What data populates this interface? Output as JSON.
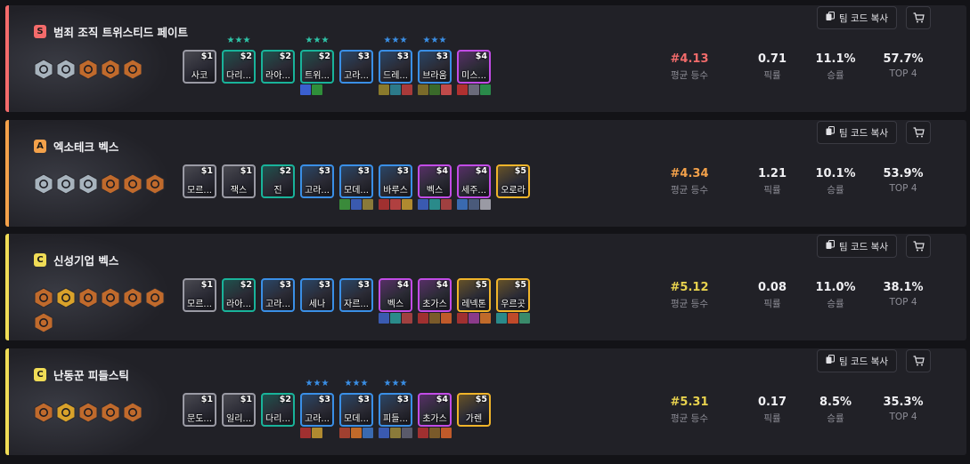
{
  "labels": {
    "copy_code": "팀 코드 복사",
    "avg_rank_label": "평균 등수",
    "pick_label": "픽률",
    "win_label": "승률",
    "top4_label": "TOP 4"
  },
  "colors": {
    "tier_S": "#f46b6b",
    "tier_A": "#f3a14a",
    "tier_C": "#f0dc56",
    "cost_1": "#9a9aa4",
    "cost_2": "#19b39a",
    "cost_3": "#3a8fe6",
    "cost_4": "#c24ce6",
    "cost_5": "#f0b42a",
    "star_2": "#2fc4a8",
    "star_3": "#3a8fe6",
    "trait_silver": "#a7b3bd",
    "trait_bronze": "#c06a2c",
    "trait_gold": "#d9a22a"
  },
  "comps": [
    {
      "tier": "S",
      "name": "범죄 조직 트위스티드 페이트",
      "traits": [
        "silver",
        "silver",
        "bronze",
        "bronze",
        "bronze"
      ],
      "units": [
        {
          "cost": "$1",
          "name": "사코",
          "tier": 1,
          "stars": "",
          "star_tier": 0,
          "items": []
        },
        {
          "cost": "$2",
          "name": "다리...",
          "tier": 2,
          "stars": "★★★",
          "star_tier": 2,
          "items": []
        },
        {
          "cost": "$2",
          "name": "라아...",
          "tier": 2,
          "stars": "",
          "star_tier": 0,
          "items": []
        },
        {
          "cost": "$2",
          "name": "트위...",
          "tier": 2,
          "stars": "★★★",
          "star_tier": 2,
          "items": [
            "#3a5fd0",
            "#2f8f3a"
          ]
        },
        {
          "cost": "$3",
          "name": "고라...",
          "tier": 3,
          "stars": "",
          "star_tier": 0,
          "items": []
        },
        {
          "cost": "$3",
          "name": "드레...",
          "tier": 3,
          "stars": "★★★",
          "star_tier": 3,
          "items": [
            "#8a7a2c",
            "#2c7a8a",
            "#a83a3a"
          ]
        },
        {
          "cost": "$3",
          "name": "브라움",
          "tier": 3,
          "stars": "★★★",
          "star_tier": 3,
          "items": [
            "#7a6a2a",
            "#3a6a2a",
            "#c04a4a"
          ]
        },
        {
          "cost": "$4",
          "name": "미스...",
          "tier": 4,
          "stars": "",
          "star_tier": 0,
          "items": [
            "#b03030",
            "#6a6a7a",
            "#2a8a4a"
          ]
        }
      ],
      "avg_rank": "#4.13",
      "pick": "0.71",
      "win": "11.1%",
      "top4": "57.7%"
    },
    {
      "tier": "A",
      "name": "엑소테크 벡스",
      "traits": [
        "silver",
        "silver",
        "silver",
        "bronze",
        "bronze",
        "bronze"
      ],
      "units": [
        {
          "cost": "$1",
          "name": "모르...",
          "tier": 1,
          "stars": "",
          "star_tier": 0,
          "items": []
        },
        {
          "cost": "$1",
          "name": "잭스",
          "tier": 1,
          "stars": "",
          "star_tier": 0,
          "items": []
        },
        {
          "cost": "$2",
          "name": "진",
          "tier": 2,
          "stars": "",
          "star_tier": 0,
          "items": []
        },
        {
          "cost": "$3",
          "name": "고라...",
          "tier": 3,
          "stars": "",
          "star_tier": 0,
          "items": []
        },
        {
          "cost": "$3",
          "name": "모데...",
          "tier": 3,
          "stars": "",
          "star_tier": 0,
          "items": [
            "#3a8a3a",
            "#3a5ab0",
            "#8a7a3a"
          ]
        },
        {
          "cost": "$3",
          "name": "바루스",
          "tier": 3,
          "stars": "",
          "star_tier": 0,
          "items": [
            "#a03030",
            "#b04040",
            "#b08a30"
          ]
        },
        {
          "cost": "$4",
          "name": "벡스",
          "tier": 4,
          "stars": "",
          "star_tier": 0,
          "items": [
            "#3a5ab0",
            "#2a8a8a",
            "#a04040"
          ]
        },
        {
          "cost": "$4",
          "name": "세주...",
          "tier": 4,
          "stars": "",
          "star_tier": 0,
          "items": [
            "#3a6ab0",
            "#4a5a7a",
            "#9a9aa4"
          ]
        },
        {
          "cost": "$5",
          "name": "오로라",
          "tier": 5,
          "stars": "",
          "star_tier": 0,
          "items": []
        }
      ],
      "avg_rank": "#4.34",
      "pick": "1.21",
      "win": "10.1%",
      "top4": "53.9%"
    },
    {
      "tier": "C",
      "name": "신성기업 벡스",
      "traits": [
        "bronze",
        "gold",
        "bronze",
        "bronze",
        "bronze",
        "bronze",
        "bronze"
      ],
      "units": [
        {
          "cost": "$1",
          "name": "모르...",
          "tier": 1,
          "stars": "",
          "star_tier": 0,
          "items": []
        },
        {
          "cost": "$2",
          "name": "라아...",
          "tier": 2,
          "stars": "",
          "star_tier": 0,
          "items": []
        },
        {
          "cost": "$3",
          "name": "고라...",
          "tier": 3,
          "stars": "",
          "star_tier": 0,
          "items": []
        },
        {
          "cost": "$3",
          "name": "세나",
          "tier": 3,
          "stars": "",
          "star_tier": 0,
          "items": []
        },
        {
          "cost": "$3",
          "name": "자르...",
          "tier": 3,
          "stars": "",
          "star_tier": 0,
          "items": []
        },
        {
          "cost": "$4",
          "name": "벡스",
          "tier": 4,
          "stars": "",
          "star_tier": 0,
          "items": [
            "#3a5ab0",
            "#2a8a8a",
            "#a04040"
          ]
        },
        {
          "cost": "$4",
          "name": "초가스",
          "tier": 4,
          "stars": "",
          "star_tier": 0,
          "items": [
            "#a03030",
            "#7a5a2a",
            "#c05a2a"
          ]
        },
        {
          "cost": "$5",
          "name": "레넥톤",
          "tier": 5,
          "stars": "",
          "star_tier": 0,
          "items": [
            "#a03030",
            "#8a3a8a",
            "#c06a2a"
          ]
        },
        {
          "cost": "$5",
          "name": "우르곳",
          "tier": 5,
          "stars": "",
          "star_tier": 0,
          "items": [
            "#2a8a8a",
            "#c04a2a",
            "#3a8a6a"
          ]
        }
      ],
      "avg_rank": "#5.12",
      "pick": "0.08",
      "win": "11.0%",
      "top4": "38.1%"
    },
    {
      "tier": "C",
      "name": "난동꾼 피들스틱",
      "traits": [
        "bronze",
        "gold",
        "bronze",
        "bronze",
        "bronze"
      ],
      "units": [
        {
          "cost": "$1",
          "name": "문도...",
          "tier": 1,
          "stars": "",
          "star_tier": 0,
          "items": []
        },
        {
          "cost": "$1",
          "name": "일리...",
          "tier": 1,
          "stars": "",
          "star_tier": 0,
          "items": []
        },
        {
          "cost": "$2",
          "name": "다리...",
          "tier": 2,
          "stars": "",
          "star_tier": 0,
          "items": []
        },
        {
          "cost": "$3",
          "name": "고라...",
          "tier": 3,
          "stars": "★★★",
          "star_tier": 3,
          "items": [
            "#a03030",
            "#b08a30"
          ]
        },
        {
          "cost": "$3",
          "name": "모데...",
          "tier": 3,
          "stars": "★★★",
          "star_tier": 3,
          "items": [
            "#a04030",
            "#c06a2a",
            "#3a6ab0"
          ]
        },
        {
          "cost": "$3",
          "name": "피들...",
          "tier": 3,
          "stars": "★★★",
          "star_tier": 3,
          "items": [
            "#3a5ab0",
            "#8a7a3a",
            "#5a5a6a"
          ]
        },
        {
          "cost": "$4",
          "name": "초가스",
          "tier": 4,
          "stars": "",
          "star_tier": 0,
          "items": [
            "#a03030",
            "#7a5a2a",
            "#c05a2a"
          ]
        },
        {
          "cost": "$5",
          "name": "가렌",
          "tier": 5,
          "stars": "",
          "star_tier": 0,
          "items": []
        }
      ],
      "avg_rank": "#5.31",
      "pick": "0.17",
      "win": "8.5%",
      "top4": "35.3%"
    }
  ]
}
